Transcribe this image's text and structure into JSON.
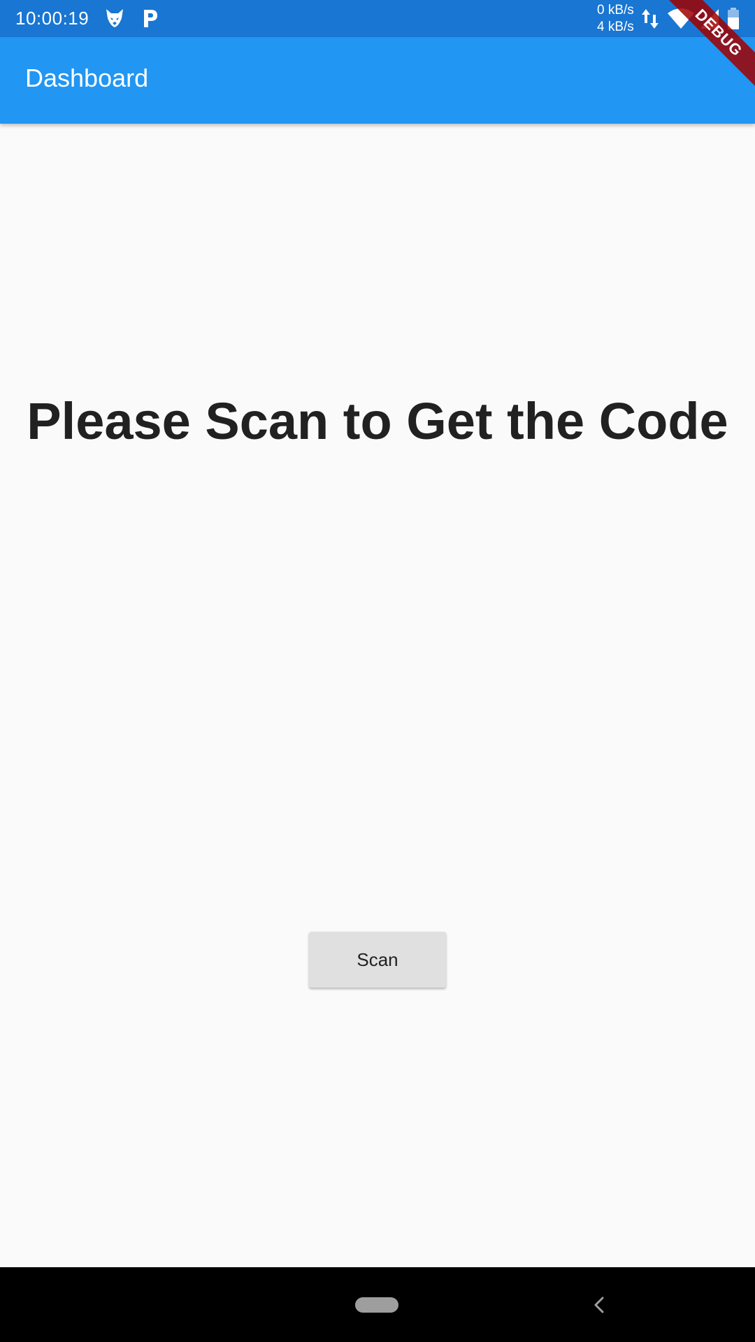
{
  "status_bar": {
    "time": "10:00:19",
    "net_up": "0 kB/s",
    "net_down": "4 kB/s",
    "icons": [
      "fox-icon",
      "p-icon",
      "data-arrows-icon",
      "wifi-icon",
      "signal-icon",
      "battery-icon"
    ],
    "color": "#1976d2"
  },
  "app_bar": {
    "title": "Dashboard",
    "color": "#2196f3"
  },
  "debug_banner": {
    "label": "DEBUG"
  },
  "main": {
    "headline": "Please Scan to Get the Code",
    "scan_button_label": "Scan"
  },
  "nav_bar": {
    "icons": [
      "home-pill-icon",
      "back-icon"
    ]
  }
}
